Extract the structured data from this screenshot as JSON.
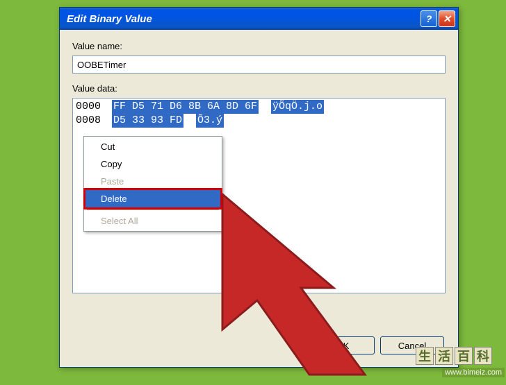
{
  "dialog": {
    "title": "Edit Binary Value",
    "value_name_label": "Value name:",
    "value_name": "OOBETimer",
    "value_data_label": "Value data:"
  },
  "hex": {
    "rows": [
      {
        "offset": "0000",
        "bytes": "FF D5 71 D6 8B 6A 8D 6F",
        "ascii": "ÿÕqÖ.j.o"
      },
      {
        "offset": "0008",
        "bytes": "D5 33 93 FD",
        "ascii": "Õ3.ý"
      }
    ]
  },
  "context_menu": {
    "items": [
      {
        "label": "Cut",
        "enabled": true
      },
      {
        "label": "Copy",
        "enabled": true
      },
      {
        "label": "Paste",
        "enabled": false
      },
      {
        "label": "Delete",
        "enabled": true,
        "highlight": true
      }
    ],
    "select_all": "Select All"
  },
  "buttons": {
    "ok": "OK",
    "cancel": "Cancel"
  },
  "watermark": {
    "chars": [
      "生",
      "活",
      "百",
      "科"
    ],
    "url": "www.bimeiz.com"
  }
}
